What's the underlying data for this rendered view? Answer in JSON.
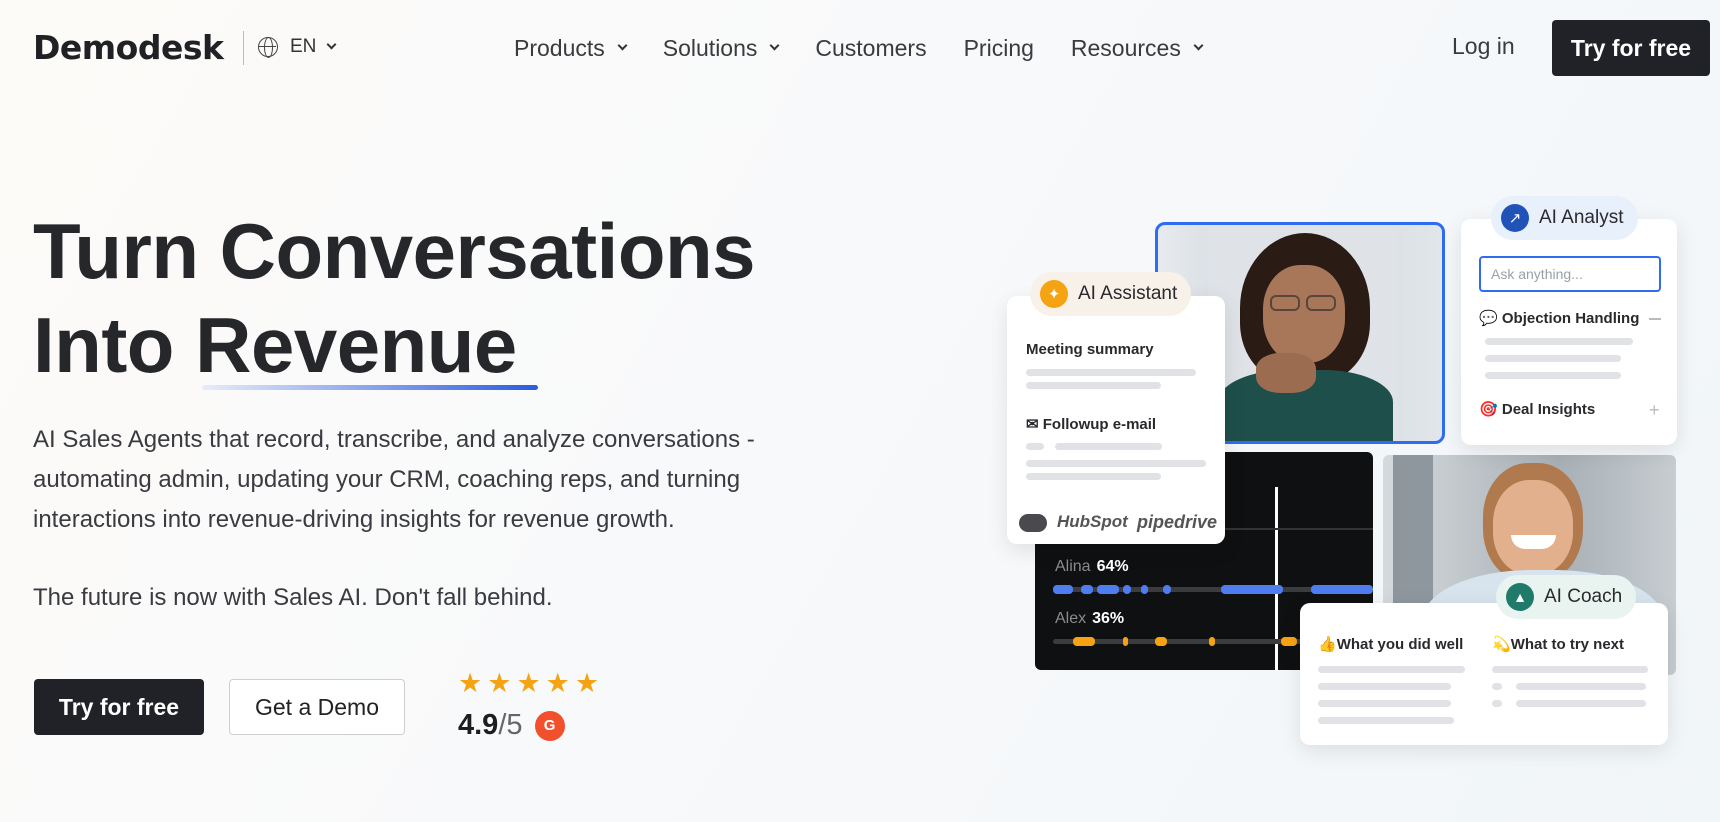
{
  "nav": {
    "logo": "Demodesk",
    "language": "EN",
    "menu": [
      {
        "label": "Products",
        "has_dropdown": true
      },
      {
        "label": "Solutions",
        "has_dropdown": true
      },
      {
        "label": "Customers",
        "has_dropdown": false
      },
      {
        "label": "Pricing",
        "has_dropdown": false
      },
      {
        "label": "Resources",
        "has_dropdown": true
      }
    ],
    "login": "Log in",
    "cta": "Try for free"
  },
  "hero": {
    "headline_line1": "Turn Conversations",
    "headline_line2_prefix": "Into ",
    "headline_line2_highlight": "Revenue",
    "description": "AI Sales Agents that record, transcribe, and analyze conversations - automating admin, updating your CRM, coaching reps, and turning interactions into revenue-driving insights for revenue growth.",
    "tagline": "The future is now with Sales AI. Don't fall behind.",
    "primary_cta": "Try for free",
    "secondary_cta": "Get a Demo",
    "rating": {
      "score": "4.9",
      "separator": "/",
      "max": "5",
      "stars": 5,
      "badge": "G"
    }
  },
  "visual": {
    "ai_assistant": {
      "label": "AI Assistant",
      "meeting_summary": "Meeting summary",
      "followup": "Followup e-mail",
      "integrations": [
        "HubSpot",
        "pipedrive"
      ]
    },
    "ai_analyst": {
      "label": "AI Analyst",
      "search_placeholder": "Ask anything...",
      "objection": "Objection Handling",
      "deal_insights": "Deal Insights"
    },
    "talk_ratio": [
      {
        "name": "Alina",
        "pct": "64%"
      },
      {
        "name": "Alex",
        "pct": "36%"
      }
    ],
    "ai_coach": {
      "label": "AI Coach",
      "did_well": "What you did well",
      "try_next": "What to try next"
    },
    "colors": {
      "accent_blue": "#2f6cf3",
      "orange": "#f6a313",
      "dark": "#202228"
    }
  }
}
